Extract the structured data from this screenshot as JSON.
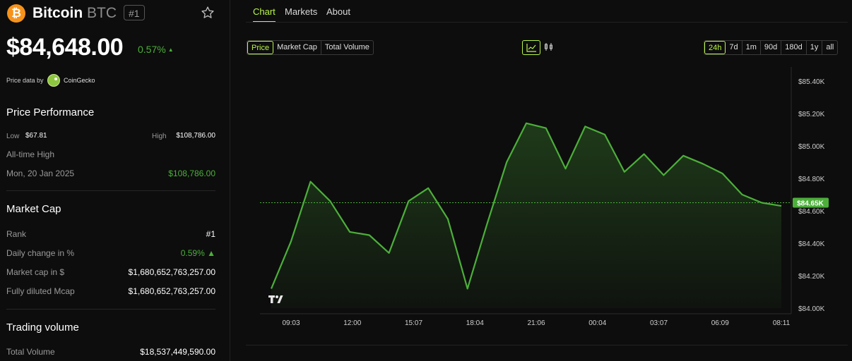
{
  "coin": {
    "logo_glyph": "₿",
    "name": "Bitcoin",
    "symbol": "BTC",
    "rank_badge": "#1",
    "price": "$84,648.00",
    "change": "0.57%",
    "change_arrow": "▲",
    "price_data_by": "Price data by",
    "provider": "CoinGecko"
  },
  "performance": {
    "title": "Price Performance",
    "low_label": "Low",
    "low_value": "$67.81",
    "high_label": "High",
    "high_value": "$108,786.00",
    "ath_label": "All-time High",
    "ath_date": "Mon, 20 Jan 2025",
    "ath_value": "$108,786.00"
  },
  "market_cap": {
    "title": "Market Cap",
    "rows": [
      {
        "label": "Rank",
        "value": "#1"
      },
      {
        "label": "Daily change in %",
        "value": "0.59% ▲"
      },
      {
        "label": "Market cap in $",
        "value": "$1,680,652,763,257.00"
      },
      {
        "label": "Fully diluted Mcap",
        "value": "$1,680,652,763,257.00"
      }
    ]
  },
  "trading_volume": {
    "title": "Trading volume",
    "rows": [
      {
        "label": "Total Volume",
        "value": "$18,537,449,590.00"
      }
    ]
  },
  "tabs": [
    "Chart",
    "Markets",
    "About"
  ],
  "metric_buttons": [
    "Price",
    "Market Cap",
    "Total Volume"
  ],
  "range_buttons": [
    "24h",
    "7d",
    "1m",
    "90d",
    "180d",
    "1y",
    "all"
  ],
  "icons": {
    "star": "star-icon",
    "line_chart": "line-chart-icon",
    "candlestick": "candlestick-icon",
    "tradingview": "tradingview-logo"
  },
  "colors": {
    "accent": "#b9f54a",
    "line": "#4caf3a",
    "brand": "#f7931a"
  },
  "chart_data": {
    "type": "area",
    "x_ticks": [
      "09:03",
      "12:00",
      "15:07",
      "18:04",
      "21:06",
      "00:04",
      "03:07",
      "06:09",
      "08:11"
    ],
    "y_ticks": [
      "$85.40K",
      "$85.20K",
      "$85.00K",
      "$84.80K",
      "$84.60K",
      "$84.40K",
      "$84.20K",
      "$84.00K"
    ],
    "ylim": [
      84000,
      85400
    ],
    "x": [
      0,
      1,
      2,
      3,
      4,
      5,
      6,
      7,
      8,
      9,
      10,
      11,
      12,
      13,
      14,
      15,
      16,
      17,
      18,
      19,
      20,
      21,
      22,
      23,
      24,
      25,
      26
    ],
    "values": [
      84120,
      84410,
      84780,
      84660,
      84470,
      84450,
      84340,
      84660,
      84740,
      84550,
      84120,
      84520,
      84900,
      85140,
      85110,
      84860,
      85120,
      85070,
      84840,
      84950,
      84820,
      84940,
      84890,
      84830,
      84700,
      84650,
      84630
    ],
    "current_value": 84650,
    "current_label": "$84.65K"
  }
}
